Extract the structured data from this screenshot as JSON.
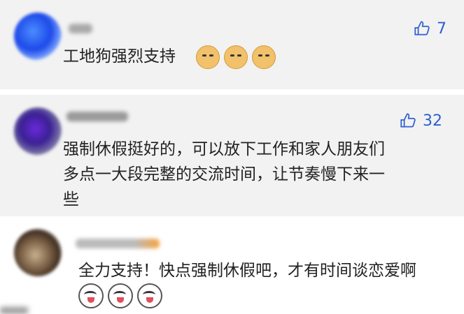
{
  "comments": [
    {
      "text_lines": [
        "工地狗强烈支持"
      ],
      "emoji": [
        "doge-emoji",
        "doge-emoji",
        "doge-emoji"
      ],
      "like_count": "7"
    },
    {
      "text_lines": [
        "强制休假挺好的，可以放下工作和家人朋友们",
        "多点一大段完整的交流时间，让节奏慢下来一",
        "些"
      ],
      "emoji": [],
      "like_count": "32"
    },
    {
      "text_lines": [
        "全力支持！快点强制休假吧，才有时间谈恋爱啊"
      ],
      "emoji": [
        "dog-emoji",
        "dog-emoji",
        "dog-emoji"
      ],
      "like_count": ""
    }
  ],
  "icons": {
    "like": "thumbs-up-icon"
  },
  "colors": {
    "accent": "#2f5fd0",
    "background": "#f2f2f2",
    "text": "#222222"
  }
}
